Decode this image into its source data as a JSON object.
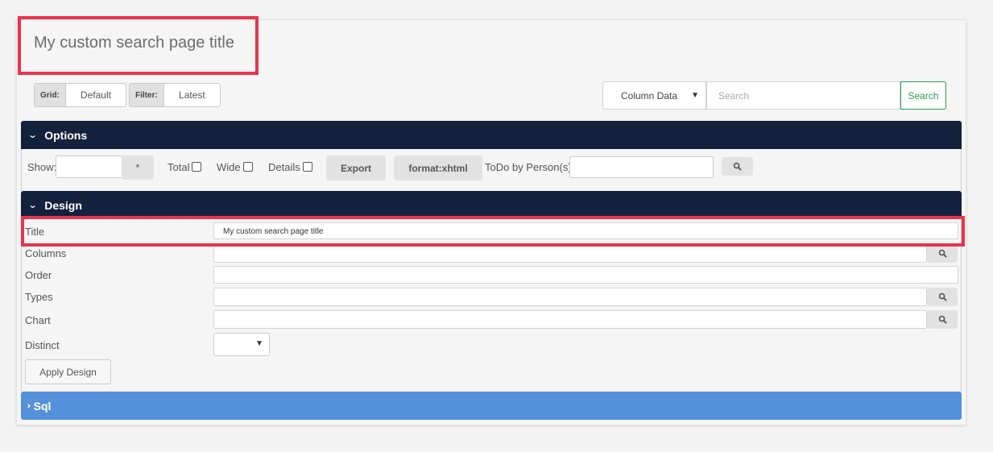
{
  "page_title": "My custom search page title",
  "toolbar": {
    "grid_label": "Grid:",
    "grid_value": "Default",
    "filter_label": "Filter:",
    "filter_value": "Latest",
    "column_select_value": "Column Data",
    "search_placeholder": "Search",
    "search_button": "Search"
  },
  "options": {
    "header": "Options",
    "show_label": "Show:",
    "star_button": "*",
    "total_label": "Total",
    "wide_label": "Wide",
    "details_label": "Details",
    "export_button": "Export",
    "format_button": "format:xhtml",
    "todo_label": "ToDo by Person(s)"
  },
  "design": {
    "header": "Design",
    "title_label": "Title",
    "title_value": "My custom search page title",
    "columns_label": "Columns",
    "order_label": "Order",
    "types_label": "Types",
    "chart_label": "Chart",
    "distinct_label": "Distinct",
    "apply_button": "Apply Design"
  },
  "sql": {
    "header": "Sql"
  },
  "colors": {
    "section_header": "#14213d",
    "sql_header": "#5590db",
    "highlight": "#e8344c",
    "search_green": "#2aa04a"
  }
}
